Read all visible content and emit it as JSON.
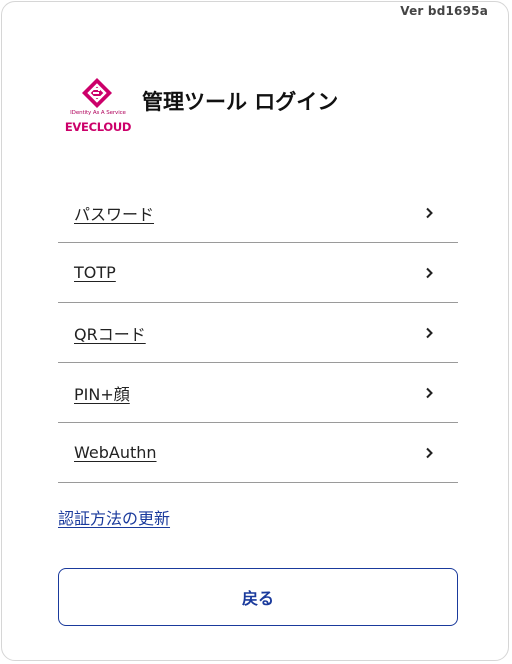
{
  "version": "Ver bd1695a",
  "logo": {
    "tagline": "IDentity As A Service",
    "brand": "EVECLOUD",
    "brand_color": "#cc006a"
  },
  "title": "管理ツール ログイン",
  "methods": [
    {
      "label": "パスワード",
      "icon": "chevron-right-icon"
    },
    {
      "label": "TOTP",
      "icon": "chevron-right-icon"
    },
    {
      "label": "QRコード",
      "icon": "chevron-right-icon"
    },
    {
      "label": "PIN+顔",
      "icon": "chevron-right-icon"
    },
    {
      "label": "WebAuthn",
      "icon": "chevron-right-icon"
    }
  ],
  "update_link": "認証方法の更新",
  "back_button": "戻る",
  "colors": {
    "accent": "#1a3a9c",
    "divider": "#9a9a9a",
    "border": "#d6d6d6"
  }
}
